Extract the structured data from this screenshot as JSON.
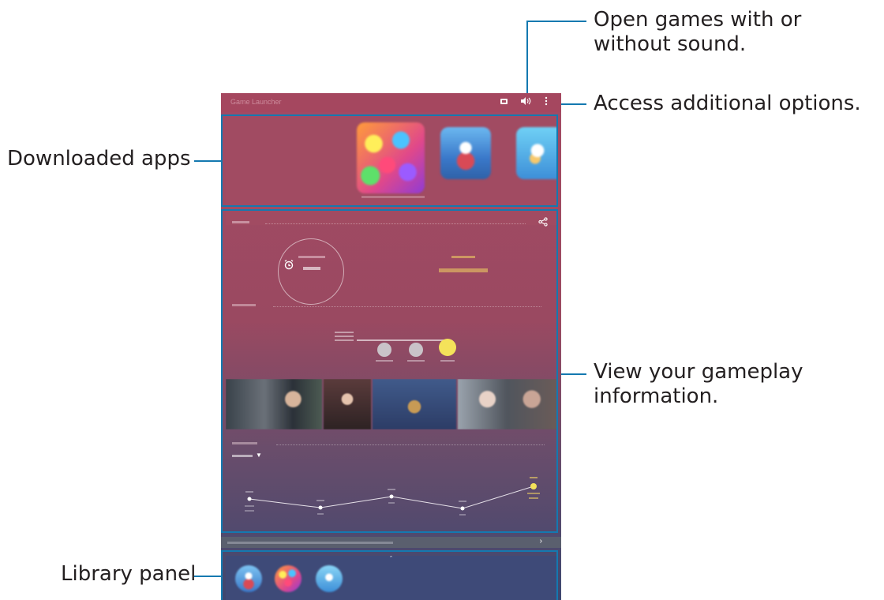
{
  "callouts": {
    "sound": "Open games with or without sound.",
    "options": "Access additional options.",
    "downloaded": "Downloaded apps",
    "gameplay": "View your gameplay information.",
    "library": "Library panel"
  },
  "app": {
    "title": "Game Launcher"
  },
  "colors": {
    "accent": "#1479b0",
    "header": "#a5475f",
    "highlight": "#f4d563"
  },
  "icons": {
    "mode": "gamepad-icon",
    "sound": "speaker-icon",
    "more": "more-vertical-icon",
    "share": "share-icon",
    "alarm": "alarm-icon",
    "chevron_up": "chevron-up-icon",
    "chevron_right": "chevron-right-icon",
    "dropdown": "caret-down-icon"
  }
}
